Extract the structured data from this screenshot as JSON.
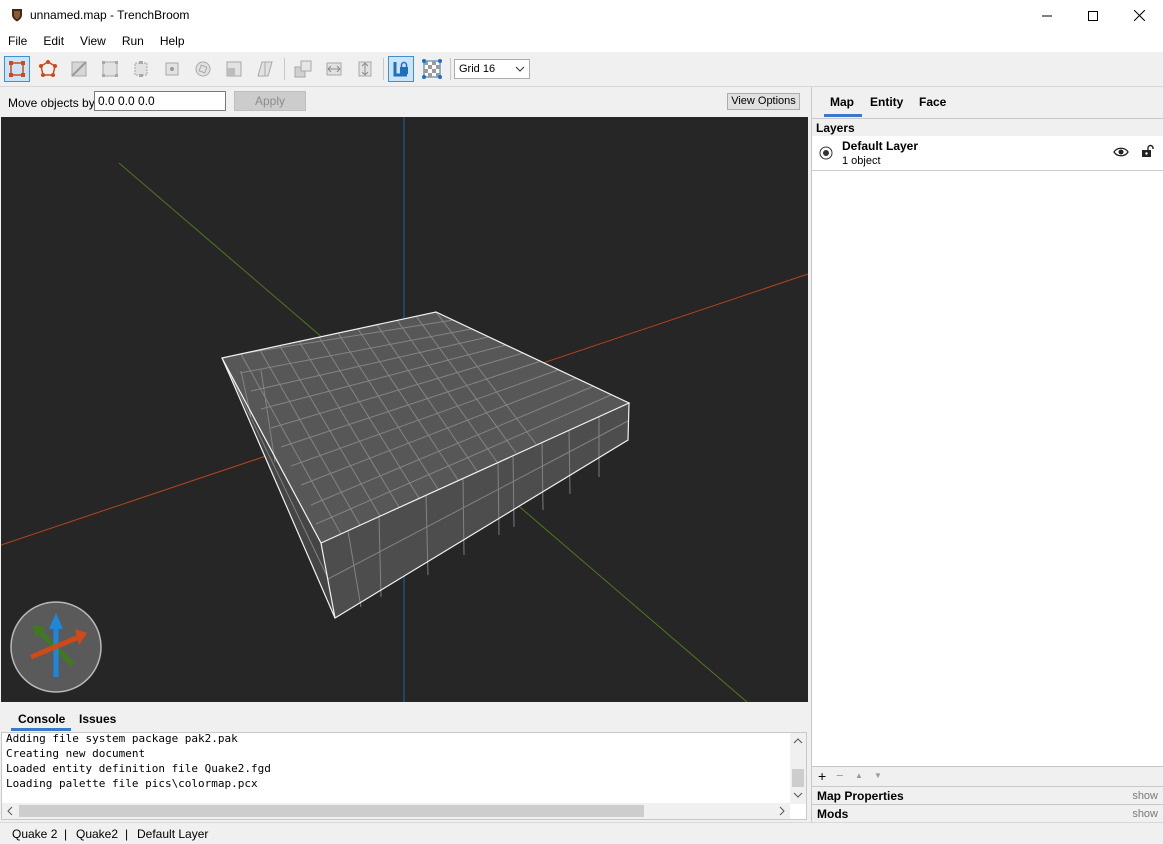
{
  "window": {
    "title": "unnamed.map - TrenchBroom",
    "minimize": "—",
    "maximize": "☐",
    "close": "✕"
  },
  "menu": [
    "File",
    "Edit",
    "View",
    "Run",
    "Help"
  ],
  "toolbar": {
    "grid_select": "Grid 16"
  },
  "movebar": {
    "label": "Move objects by",
    "input_value": "0.0 0.0 0.0",
    "apply_label": "Apply",
    "view_options_label": "View Options"
  },
  "console": {
    "tabs": [
      "Console",
      "Issues"
    ],
    "lines": [
      "Adding file system package pak2.pak",
      "Creating new document",
      "Loaded entity definition file Quake2.fgd",
      "Loading palette file pics\\colormap.pcx"
    ]
  },
  "statusbar": {
    "game": "Quake 2",
    "sep1": "|",
    "engine": "Quake2",
    "sep2": "|",
    "layer": "Default Layer"
  },
  "rightpanel": {
    "tabs": [
      "Map",
      "Entity",
      "Face"
    ],
    "layers_title": "Layers",
    "layer_name": "Default Layer",
    "layer_count": "1 object",
    "footer_add": "+",
    "footer_remove": "−",
    "footer_up": "▲",
    "footer_down": "▼",
    "map_properties": "Map Properties",
    "map_properties_toggle": "show",
    "mods": "Mods",
    "mods_toggle": "show"
  },
  "colors": {
    "x_axis": "#c0471f",
    "y_axis": "#5a8a22",
    "z_axis": "#1f6fbf",
    "selection_accent": "#3a79c9"
  }
}
